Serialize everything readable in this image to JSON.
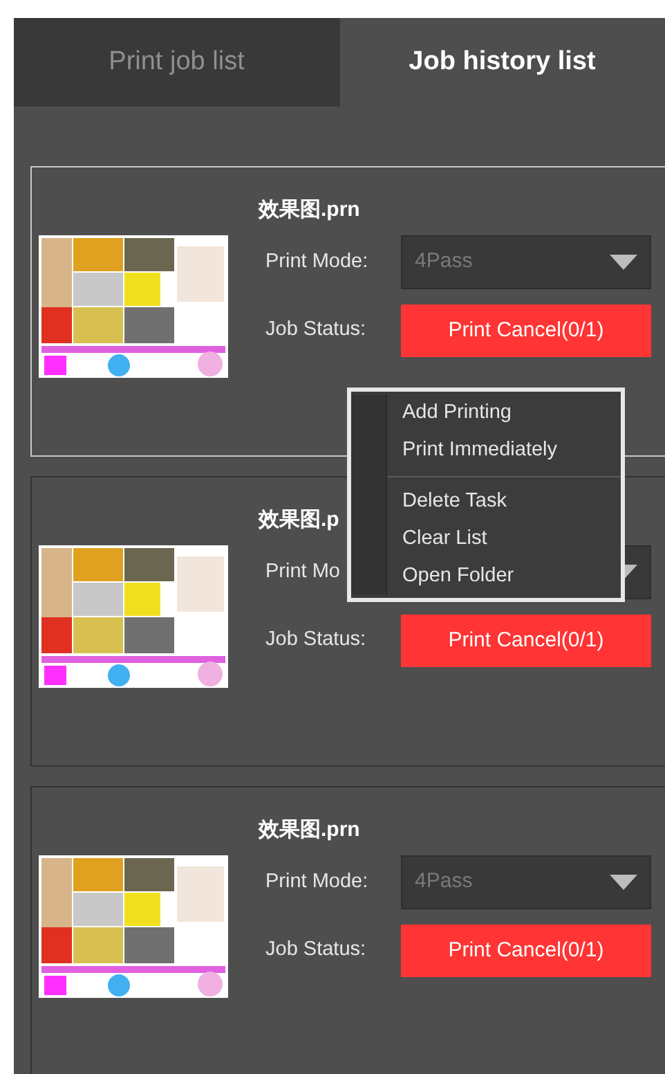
{
  "tabs": [
    {
      "label": "Print job list",
      "selected": false
    },
    {
      "label": "Job history list",
      "selected": true
    }
  ],
  "jobs": [
    {
      "file": "效果图.prn",
      "selected": true,
      "mode_label": "Print Mode:",
      "mode_value": "4Pass",
      "status_label": "Job Status:",
      "status": "Print Cancel(0/1)"
    },
    {
      "file": "效果图.p",
      "selected": false,
      "mode_label": "Print Mo",
      "status_label": "Job Status:",
      "status": "Print Cancel(0/1)"
    },
    {
      "file": "效果图.prn",
      "selected": false,
      "mode_label": "Print Mode:",
      "mode_value": "4Pass",
      "status_label": "Job Status:",
      "status": "Print Cancel(0/1)"
    }
  ],
  "context_menu": {
    "items": [
      {
        "kind": "item",
        "label": "Add Printing"
      },
      {
        "kind": "item",
        "label": "Print Immediately"
      },
      {
        "kind": "separator"
      },
      {
        "kind": "item",
        "label": "Delete Task"
      },
      {
        "kind": "item",
        "label": "Clear List"
      },
      {
        "kind": "item",
        "label": "Open Folder"
      }
    ]
  }
}
